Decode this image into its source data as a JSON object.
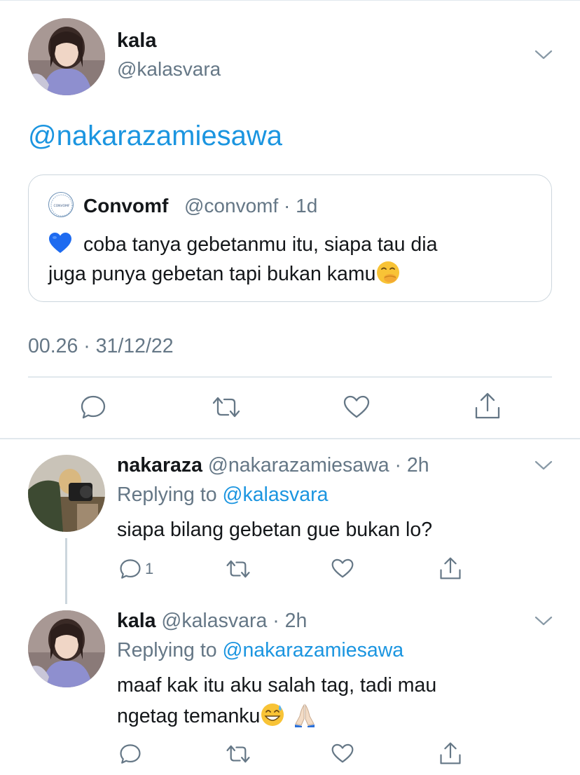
{
  "tweet": {
    "author_name": "kala",
    "author_handle": "@kalasvara",
    "text_mention": "@nakarazamiesawa",
    "timestamp": "00.26 · 31/12/22",
    "quote": {
      "name": "Convomf",
      "meta": "@convomf · 1d",
      "avatar_text": "CONVOMF",
      "line1": "coba tanya gebetanmu itu, siapa tau dia",
      "line2": "juga punya gebetan tapi bukan kamu"
    }
  },
  "replies": [
    {
      "name": "nakaraza",
      "meta": " @nakarazamiesawa · 2h",
      "replying_prefix": "Replying to ",
      "replying_handle": "@kalasvara",
      "text": "siapa bilang gebetan gue bukan lo?",
      "reply_count": "1"
    },
    {
      "name": "kala",
      "meta": " @kalasvara · 2h",
      "replying_prefix": "Replying to ",
      "replying_handle": "@nakarazamiesawa",
      "line1": "maaf kak itu aku salah tag, tadi mau",
      "line2": "ngetag temanku"
    }
  ],
  "colors": {
    "link": "#1b95e0",
    "secondary_text": "#657786",
    "divider": "#e1e8ed"
  }
}
